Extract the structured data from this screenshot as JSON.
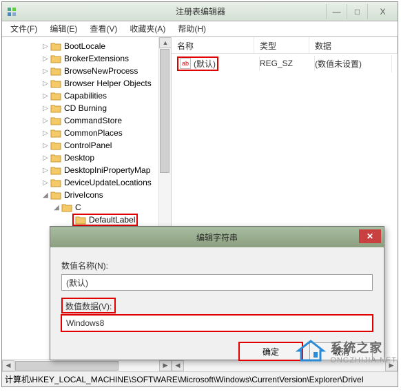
{
  "window": {
    "title": "注册表编辑器",
    "controls": {
      "min": "—",
      "max": "□",
      "close": "X"
    }
  },
  "menubar": [
    {
      "label": "文件(F)"
    },
    {
      "label": "编辑(E)"
    },
    {
      "label": "查看(V)"
    },
    {
      "label": "收藏夹(A)"
    },
    {
      "label": "帮助(H)"
    }
  ],
  "tree": {
    "items": [
      {
        "indent": 56,
        "exp": "▷",
        "label": "BootLocale"
      },
      {
        "indent": 56,
        "exp": "▷",
        "label": "BrokerExtensions"
      },
      {
        "indent": 56,
        "exp": "▷",
        "label": "BrowseNewProcess"
      },
      {
        "indent": 56,
        "exp": "▷",
        "label": "Browser Helper Objects"
      },
      {
        "indent": 56,
        "exp": "▷",
        "label": "Capabilities"
      },
      {
        "indent": 56,
        "exp": "▷",
        "label": "CD Burning"
      },
      {
        "indent": 56,
        "exp": "▷",
        "label": "CommandStore"
      },
      {
        "indent": 56,
        "exp": "▷",
        "label": "CommonPlaces"
      },
      {
        "indent": 56,
        "exp": "▷",
        "label": "ControlPanel"
      },
      {
        "indent": 56,
        "exp": "▷",
        "label": "Desktop"
      },
      {
        "indent": 56,
        "exp": "▷",
        "label": "DesktopIniPropertyMap"
      },
      {
        "indent": 56,
        "exp": "▷",
        "label": "DeviceUpdateLocations"
      },
      {
        "indent": 56,
        "exp": "◢",
        "label": "DriveIcons"
      },
      {
        "indent": 72,
        "exp": "◢",
        "label": "C"
      },
      {
        "indent": 88,
        "exp": "",
        "label": "DefaultLabel",
        "highlighted": true
      }
    ]
  },
  "list": {
    "columns": [
      "名称",
      "类型",
      "数据"
    ],
    "row": {
      "name": "(默认)",
      "type": "REG_SZ",
      "data": "(数值未设置)"
    }
  },
  "statusbar": "计算机\\HKEY_LOCAL_MACHINE\\SOFTWARE\\Microsoft\\Windows\\CurrentVersion\\Explorer\\DriveI",
  "dialog": {
    "title": "编辑字符串",
    "name_label": "数值名称(N):",
    "name_value": "(默认)",
    "data_label": "数值数据(V):",
    "data_value": "Windows8",
    "ok": "确定",
    "cancel": "取消"
  },
  "watermark": {
    "line1": "系统之家",
    "line2": "ONGZHIJIA.NET"
  }
}
